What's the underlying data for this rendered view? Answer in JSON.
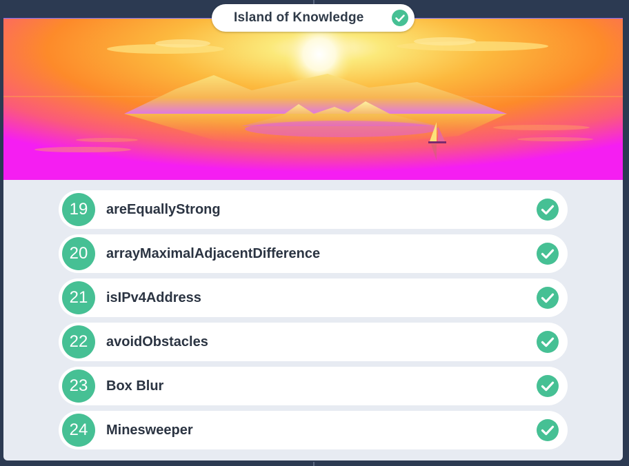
{
  "header": {
    "title": "Island of Knowledge",
    "completed_icon": "check-circle-icon"
  },
  "colors": {
    "accent_green": "#46c094",
    "background": "#2c3a52",
    "card": "#e7ebf2"
  },
  "tasks": [
    {
      "number": "19",
      "name": "areEquallyStrong",
      "status_icon": "check-circle-icon"
    },
    {
      "number": "20",
      "name": "arrayMaximalAdjacentDifference",
      "status_icon": "check-circle-icon"
    },
    {
      "number": "21",
      "name": "isIPv4Address",
      "status_icon": "check-circle-icon"
    },
    {
      "number": "22",
      "name": "avoidObstacles",
      "status_icon": "check-circle-icon"
    },
    {
      "number": "23",
      "name": "Box Blur",
      "status_icon": "check-circle-icon"
    },
    {
      "number": "24",
      "name": "Minesweeper",
      "status_icon": "check-circle-icon"
    }
  ]
}
